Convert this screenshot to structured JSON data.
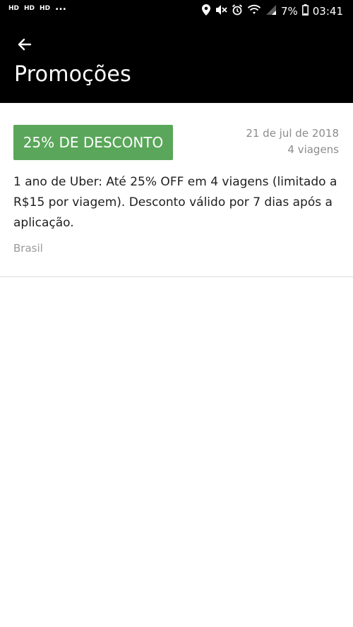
{
  "status_bar": {
    "left_indicators": [
      "HD",
      "HD",
      "HD"
    ],
    "more": "...",
    "battery": "7%",
    "time": "03:41",
    "icons": [
      "location-icon",
      "mute-icon",
      "alarm-icon",
      "wifi-icon",
      "signal-icon",
      "battery-icon"
    ]
  },
  "header": {
    "title": "Promoções",
    "back_icon": "arrow-left-icon"
  },
  "promotion": {
    "badge": "25% DE DESCONTO",
    "date": "21 de jul de 2018",
    "trips": "4 viagens",
    "description": "1 ano de Uber: Até 25% OFF em 4 viagens (limitado a R$15 por viagem). Desconto válido por 7 dias após a aplicação.",
    "region": "Brasil",
    "badge_color": "#5aa65a"
  }
}
